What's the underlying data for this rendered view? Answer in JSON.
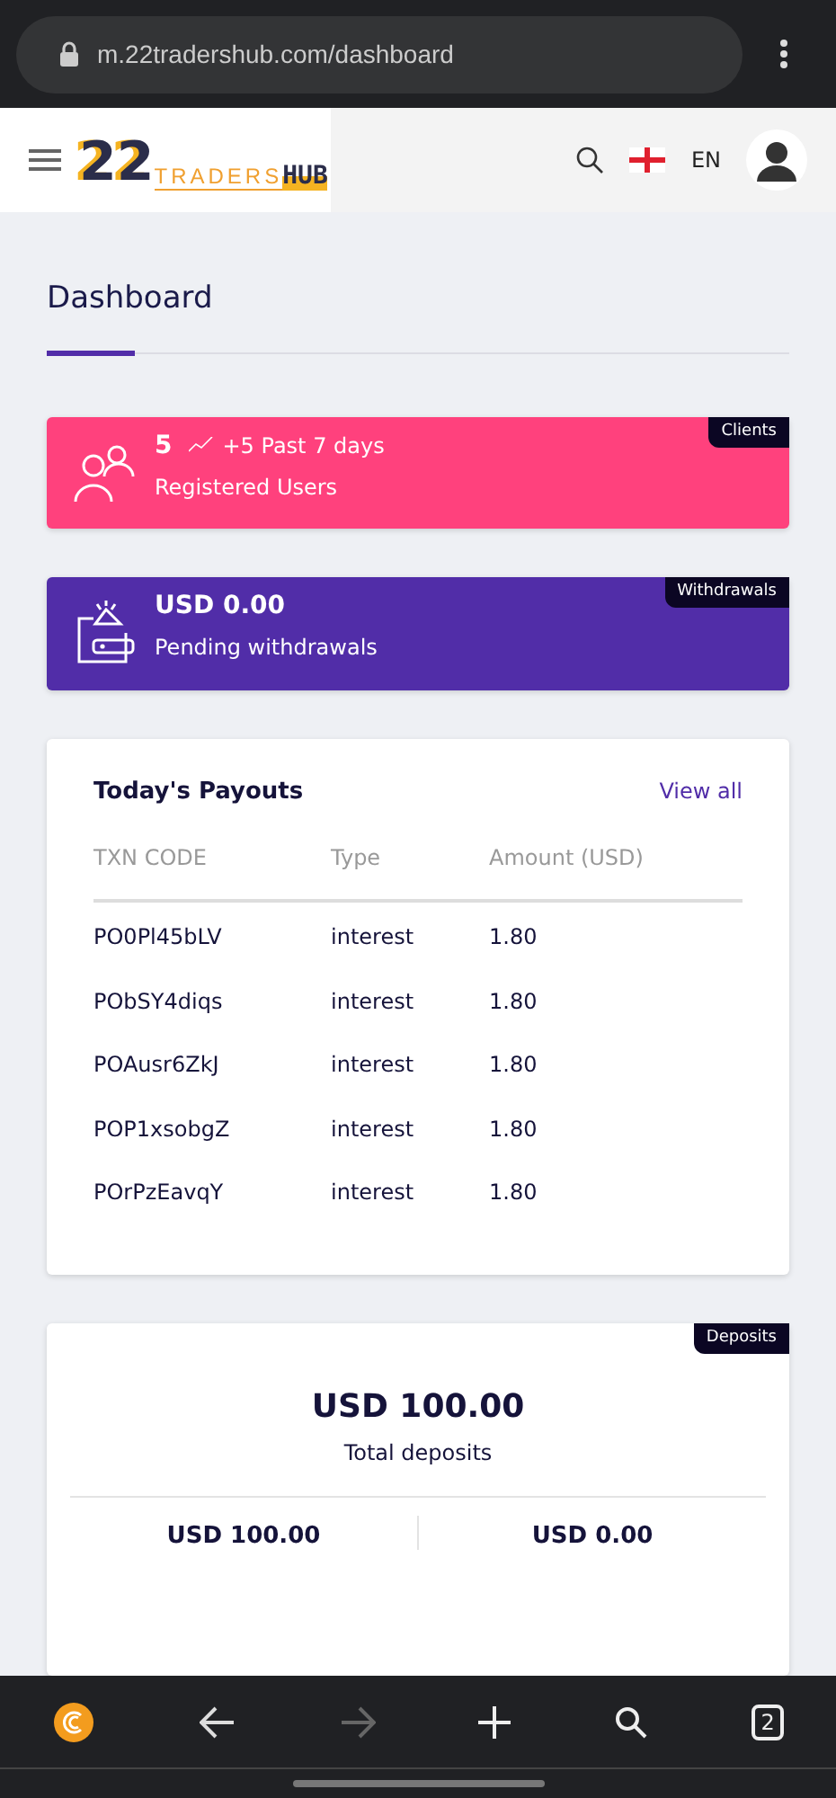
{
  "browser": {
    "url": "m.22tradershub.com/dashboard"
  },
  "header": {
    "logo": {
      "number": "22",
      "word": "TRADERS",
      "badge": "HUB"
    },
    "language": "EN"
  },
  "page_title": "Dashboard",
  "stat_cards": [
    {
      "tag": "Clients",
      "value": "5",
      "trend": "+5 Past 7 days",
      "label": "Registered Users",
      "color": "#ff417d",
      "kind": "users"
    },
    {
      "tag": "Withdrawals",
      "value": "USD 0.00",
      "label": "Pending withdrawals",
      "color": "#512da8",
      "kind": "wallet"
    }
  ],
  "payouts": {
    "title": "Today's Payouts",
    "link": "View all",
    "columns": [
      "TXN CODE",
      "Type",
      "Amount (USD)"
    ],
    "rows": [
      [
        "PO0Pl45bLV",
        "interest",
        "1.80"
      ],
      [
        "PObSY4diqs",
        "interest",
        "1.80"
      ],
      [
        "POAusr6ZkJ",
        "interest",
        "1.80"
      ],
      [
        "POP1xsobgZ",
        "interest",
        "1.80"
      ],
      [
        "POrPzEavqY",
        "interest",
        "1.80"
      ]
    ]
  },
  "deposits": {
    "tag": "Deposits",
    "total": "USD 100.00",
    "total_label": "Total deposits",
    "parts": [
      "USD 100.00",
      "USD 0.00"
    ]
  },
  "bottom_bar": {
    "tab_count": "2"
  }
}
